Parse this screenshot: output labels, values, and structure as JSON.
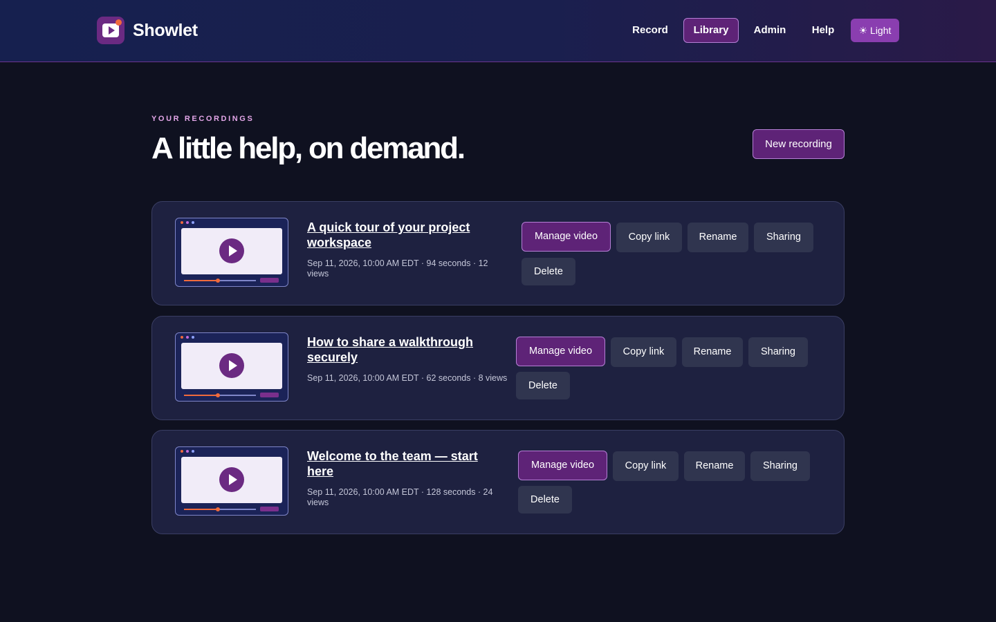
{
  "app": {
    "name": "Showlet"
  },
  "nav": {
    "items": [
      {
        "label": "Record",
        "active": false
      },
      {
        "label": "Library",
        "active": true
      },
      {
        "label": "Admin",
        "active": false
      },
      {
        "label": "Help",
        "active": false
      }
    ],
    "theme_toggle": "☀ Light"
  },
  "page": {
    "eyebrow": "YOUR RECORDINGS",
    "title": "A little help, on demand.",
    "new_button": "New recording"
  },
  "actions": {
    "manage": "Manage video",
    "copy": "Copy link",
    "rename": "Rename",
    "sharing": "Sharing",
    "delete": "Delete"
  },
  "recordings": [
    {
      "title": "A quick tour of your project workspace",
      "meta": "Sep 11, 2026, 10:00 AM EDT · 94 seconds · 12 views"
    },
    {
      "title": "How to share a walkthrough securely",
      "meta": "Sep 11, 2026, 10:00 AM EDT · 62 seconds · 8 views"
    },
    {
      "title": "Welcome to the team — start here",
      "meta": "Sep 11, 2026, 10:00 AM EDT · 128 seconds · 24 views"
    }
  ],
  "colors": {
    "background": "#0f1120",
    "card": "#1e2140",
    "accent": "#5e2377",
    "accent_border": "#b680d6",
    "secondary_button": "#30354f",
    "eyebrow": "#e3a6e8",
    "progress": "#f06a3c"
  }
}
